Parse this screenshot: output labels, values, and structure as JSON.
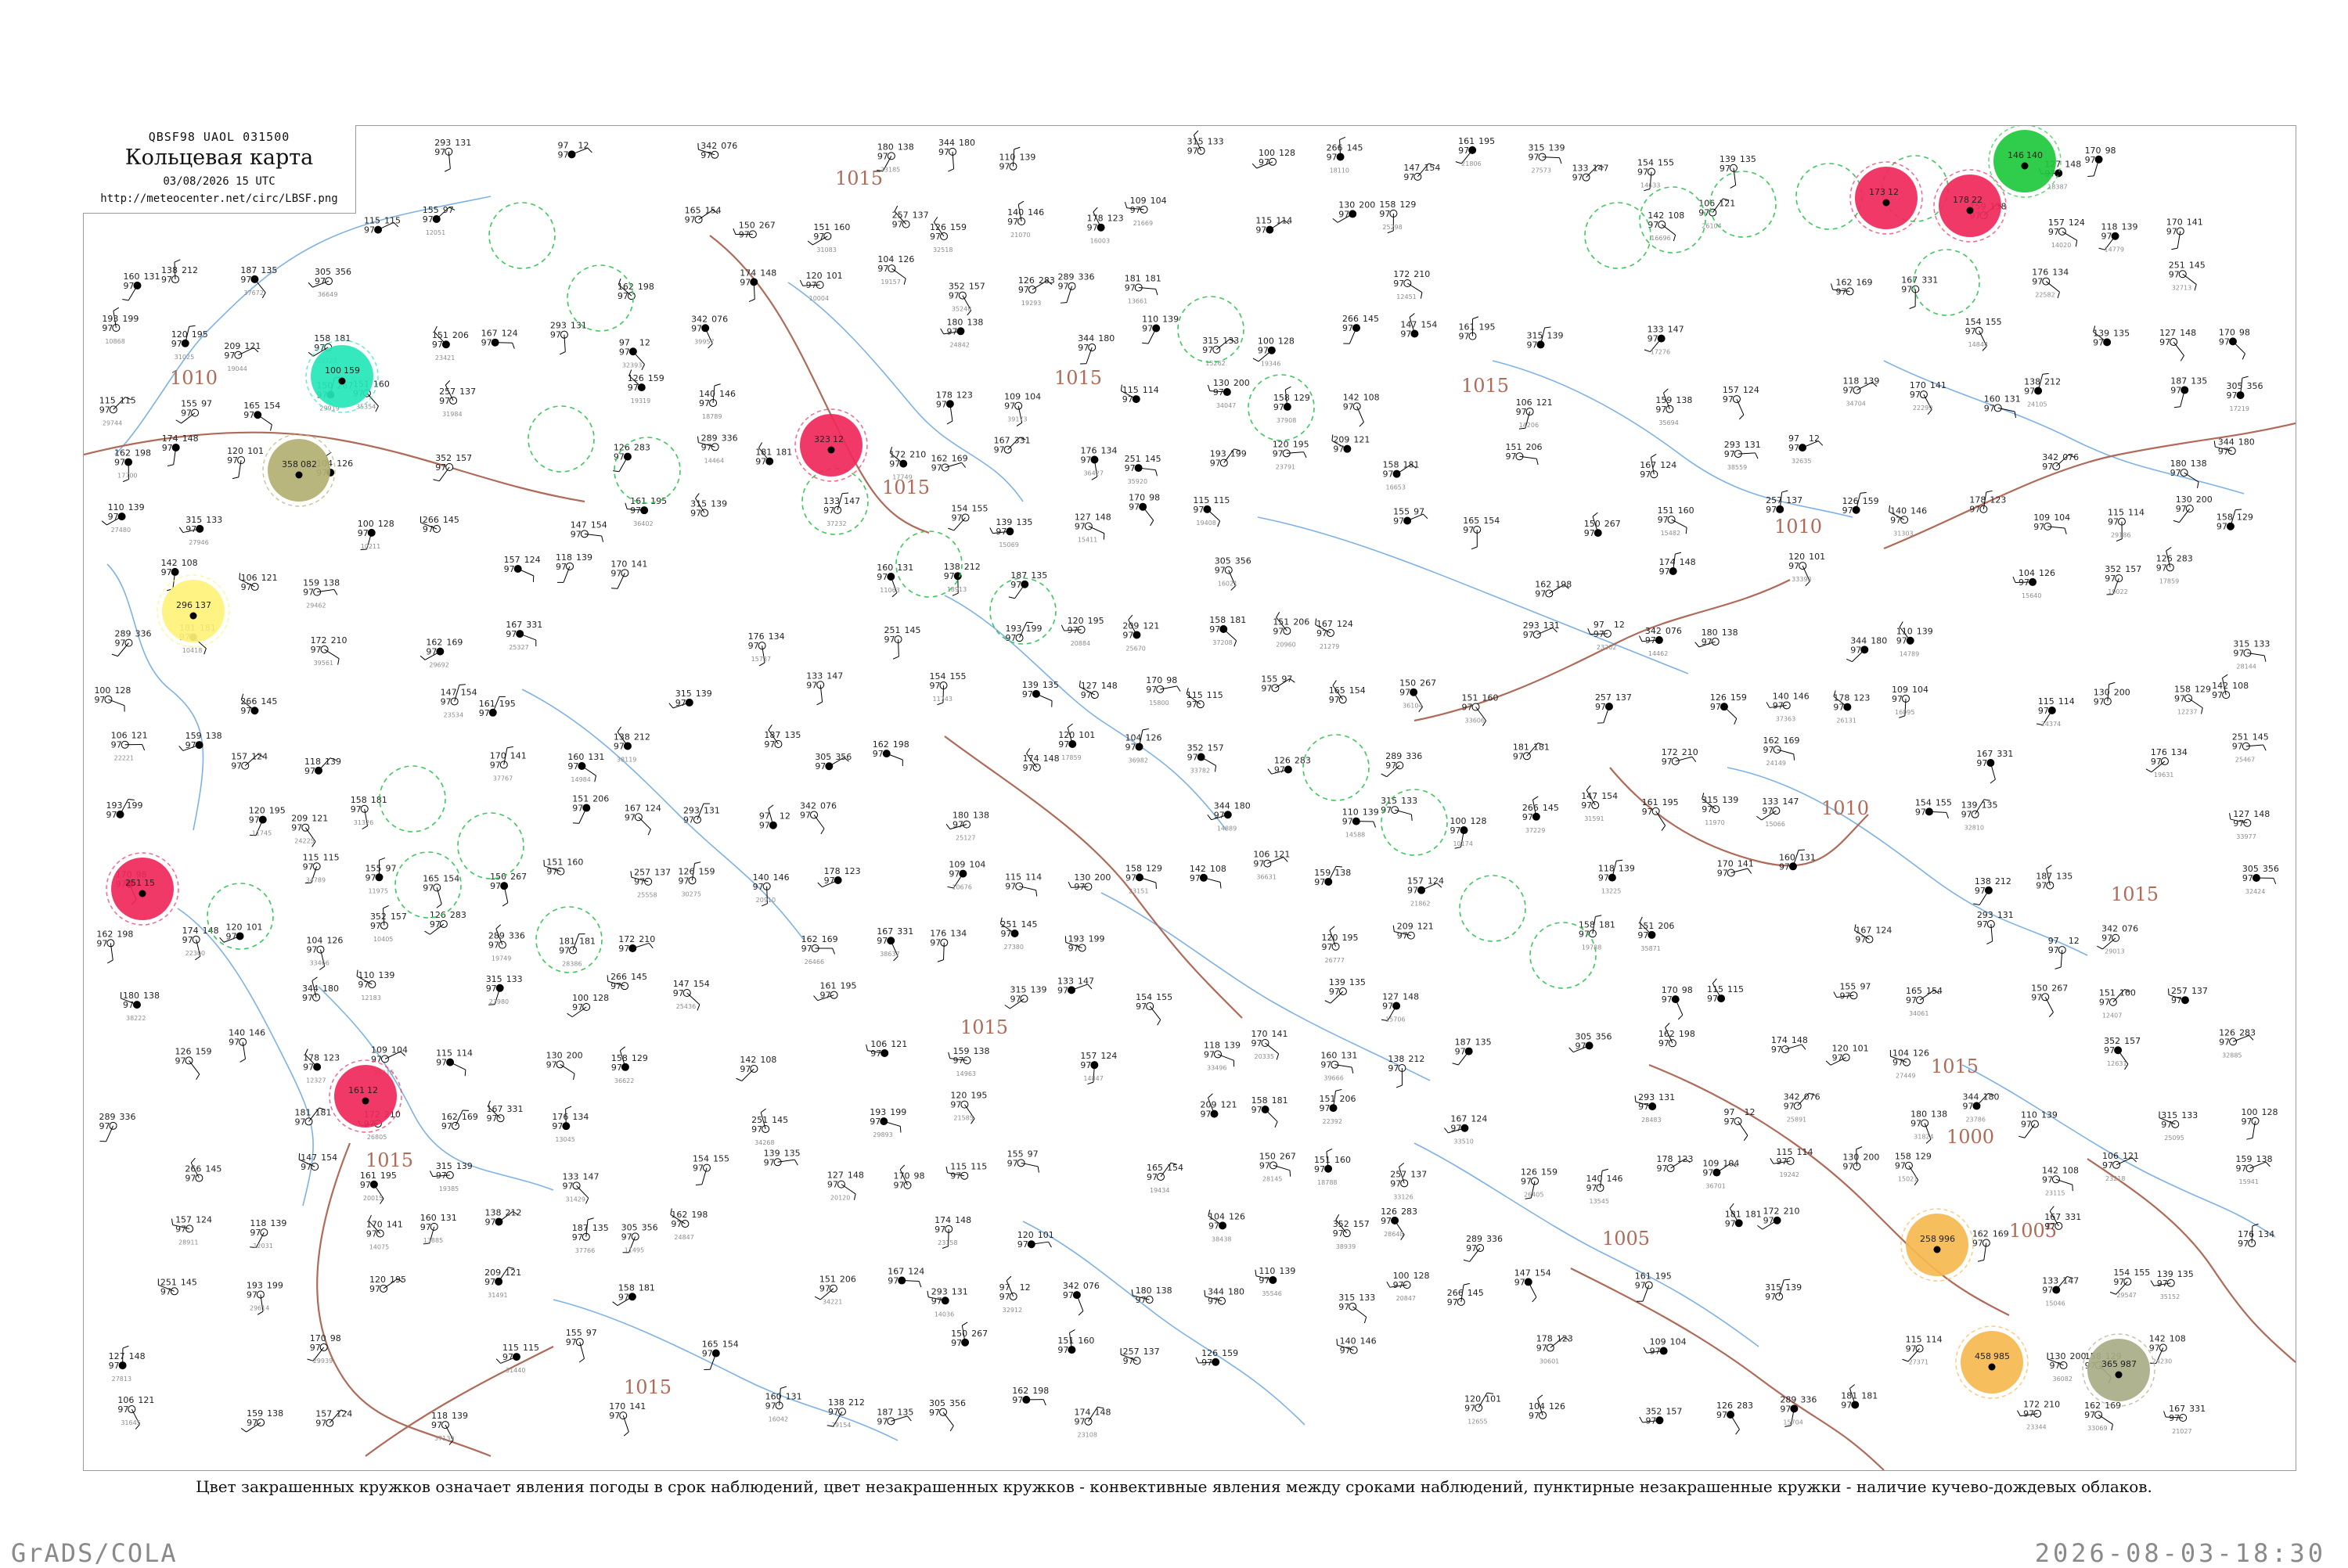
{
  "header": {
    "codes": "QBSF98  UAOL  031500",
    "title": "Кольцевая карта",
    "datetime": "03/08/2026 15 UTC",
    "url": "http://meteocenter.net/circ/LBSF.png"
  },
  "isobars": {
    "labels": [
      "1015",
      "1010",
      "1015",
      "1015",
      "1015",
      "1015",
      "1015",
      "1010",
      "1015",
      "1010",
      "1015",
      "1005",
      "1000",
      "1005",
      "1015"
    ]
  },
  "highlight_circles": [
    {
      "color": "#f0285a",
      "values": [
        "323",
        "12"
      ]
    },
    {
      "color": "#f0285a",
      "values": [
        "173",
        "12"
      ]
    },
    {
      "color": "#f0285a",
      "values": [
        "178",
        "22"
      ]
    },
    {
      "color": "#f0285a",
      "values": [
        "251",
        "15"
      ]
    },
    {
      "color": "#f0285a",
      "values": [
        "161",
        "12"
      ]
    },
    {
      "color": "#25e6b8",
      "values": [
        "100",
        "159"
      ]
    },
    {
      "color": "#b2b072",
      "values": [
        "358",
        "082"
      ]
    },
    {
      "color": "#fff27a",
      "values": [
        "296",
        "137"
      ]
    },
    {
      "color": "#1ec83c",
      "values": [
        "146",
        "140"
      ]
    },
    {
      "color": "#f5b84e",
      "values": [
        "258",
        "996"
      ]
    },
    {
      "color": "#f5b84e",
      "values": [
        "458",
        "985"
      ]
    },
    {
      "color": "#a8ad85",
      "values": [
        "365",
        "987"
      ]
    }
  ],
  "station_values": [
    "293",
    "131",
    "97",
    "12",
    "342",
    "076",
    "180",
    "138",
    "344",
    "180",
    "110",
    "139",
    "315",
    "133",
    "100",
    "128",
    "266",
    "145",
    "147",
    "154",
    "161",
    "195",
    "315",
    "139",
    "133",
    "147",
    "154",
    "155",
    "139",
    "135",
    "127",
    "148",
    "170",
    "98",
    "115",
    "115",
    "155",
    "97",
    "165",
    "154",
    "150",
    "267",
    "151",
    "160",
    "257",
    "137",
    "126",
    "159",
    "140",
    "146",
    "178",
    "123",
    "109",
    "104",
    "115",
    "114",
    "130",
    "200",
    "158",
    "129",
    "142",
    "108",
    "106",
    "121",
    "159",
    "138",
    "157",
    "124",
    "118",
    "139",
    "170",
    "141",
    "160",
    "131",
    "138",
    "212",
    "187",
    "135",
    "305",
    "356",
    "162",
    "198",
    "174",
    "148",
    "120",
    "101",
    "104",
    "126",
    "352",
    "157",
    "126",
    "283",
    "289",
    "336",
    "181",
    "181",
    "172",
    "210",
    "162",
    "169",
    "167",
    "331",
    "176",
    "134",
    "251",
    "145",
    "193",
    "199",
    "120",
    "195",
    "209",
    "121",
    "158",
    "181",
    "151",
    "206",
    "167",
    "124"
  ],
  "caption": "Цвет закрашенных кружков означает явления погоды в срок наблюдений, цвет незакрашенных кружков - конвективные явления между сроками наблюдений, пунктирные незакрашенные кружки - наличие кучево-дождевых облаков.",
  "footer": {
    "left": "GrADS/COLA",
    "right": "2026-08-03-18:30"
  },
  "colors": {
    "isobar": "#b06a58",
    "rivers": "#7db2e6",
    "coast": "#7db2e6",
    "thunder_dashed": "#3cc85a"
  }
}
